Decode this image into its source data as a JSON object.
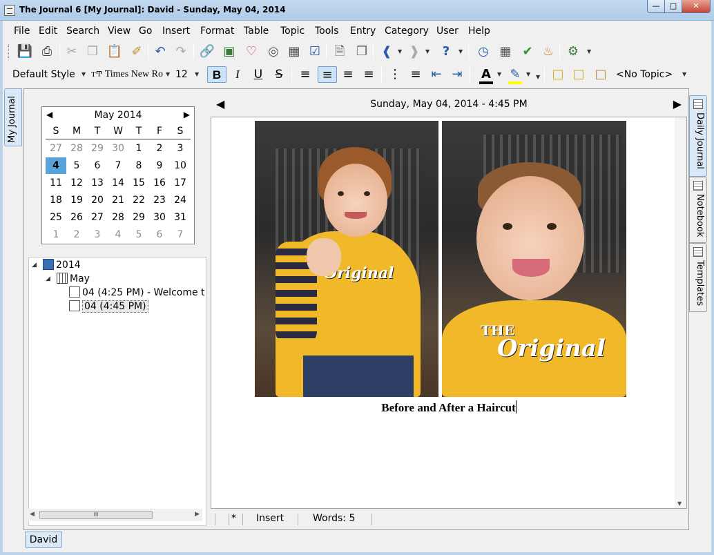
{
  "window": {
    "title": "The Journal 6 [My Journal]: David - Sunday, May 04, 2014",
    "controls": {
      "minimize": "—",
      "maximize": "□",
      "close": "✕"
    }
  },
  "menu": [
    "File",
    "Edit",
    "Search",
    "View",
    "Go",
    "Insert",
    "Format",
    "Table",
    "Topic",
    "Tools",
    "Entry",
    "Category",
    "User",
    "Help"
  ],
  "toolbar": {
    "style": "Default Style",
    "font": "Times New Ro",
    "font_size": "12",
    "topic": "<No Topic>",
    "font_color": "#000000",
    "highlight_color": "#ffff00",
    "icons": [
      "save-icon",
      "print-icon",
      "cut-icon",
      "copy-icon",
      "paste-icon",
      "format-painter-icon",
      "undo-icon",
      "redo-icon",
      "link-icon",
      "image-icon",
      "emotion-icon",
      "media-icon",
      "table-icon",
      "checkbox-icon",
      "new-entry-icon",
      "copy-entry-icon",
      "back-icon",
      "forward-icon",
      "help-icon",
      "clock-icon",
      "calendar-icon",
      "check-icon",
      "cake-icon",
      "settings-icon"
    ]
  },
  "tabs": {
    "left": "My Journal",
    "right": [
      "Daily Journal",
      "Notebook",
      "Templates"
    ],
    "bottom": "David"
  },
  "calendar": {
    "month": "May 2014",
    "dow": [
      "S",
      "M",
      "T",
      "W",
      "T",
      "F",
      "S"
    ],
    "weeks": [
      [
        "27",
        "28",
        "29",
        "30",
        "1",
        "2",
        "3"
      ],
      [
        "4",
        "5",
        "6",
        "7",
        "8",
        "9",
        "10"
      ],
      [
        "11",
        "12",
        "13",
        "14",
        "15",
        "16",
        "17"
      ],
      [
        "18",
        "19",
        "20",
        "21",
        "22",
        "23",
        "24"
      ],
      [
        "25",
        "26",
        "27",
        "28",
        "29",
        "30",
        "31"
      ],
      [
        "1",
        "2",
        "3",
        "4",
        "5",
        "6",
        "7"
      ]
    ],
    "selected": "4"
  },
  "tree": {
    "year": "2014",
    "month": "May",
    "entries": [
      "04 (4:25 PM) - Welcome t",
      "04 (4:45 PM)"
    ]
  },
  "editor": {
    "date_header": "Sunday, May 04, 2014 - 4:45 PM",
    "caption": "Before and After a Haircut",
    "photo_text": [
      "Original",
      "THE",
      "Original"
    ]
  },
  "status": {
    "modified": "*",
    "mode": "Insert",
    "words": "Words: 5",
    "scroll_thumb": "III"
  }
}
